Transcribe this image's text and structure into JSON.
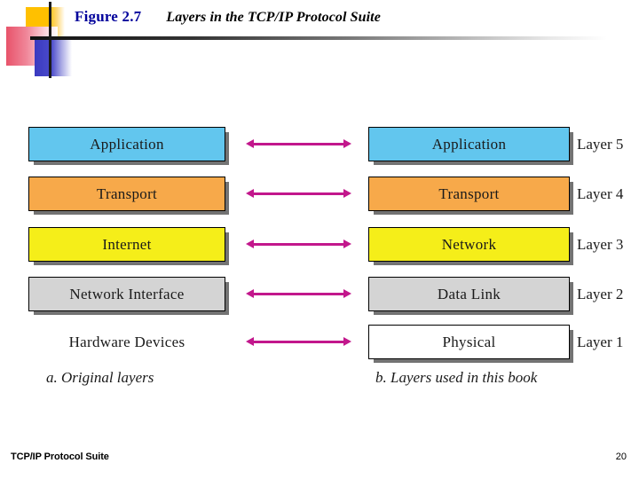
{
  "slide": {
    "title_figure": "Figure 2.7",
    "title_text": "Layers in the TCP/IP Protocol Suite",
    "accent_blue": "#00009B",
    "arrow_color": "#C2178C"
  },
  "diagram": {
    "left_column": {
      "caption": "a. Original layers",
      "rows": [
        {
          "label": "Application",
          "color": "#62C6EE",
          "boxed": true
        },
        {
          "label": "Transport",
          "color": "#F7A94A",
          "boxed": true
        },
        {
          "label": "Internet",
          "color": "#F5EE19",
          "boxed": true
        },
        {
          "label": "Network Interface",
          "color": "#D4D4D4",
          "boxed": true
        },
        {
          "label": "Hardware Devices",
          "color": "",
          "boxed": false
        }
      ]
    },
    "right_column": {
      "caption": "b. Layers used in this book",
      "rows": [
        {
          "label": "Application",
          "color": "#62C6EE",
          "layer": "Layer 5"
        },
        {
          "label": "Transport",
          "color": "#F7A94A",
          "layer": "Layer 4"
        },
        {
          "label": "Network",
          "color": "#F5EE19",
          "layer": "Layer 3"
        },
        {
          "label": "Data Link",
          "color": "#D4D4D4",
          "layer": "Layer 2"
        },
        {
          "label": "Physical",
          "color": "#FFFFFF",
          "layer": "Layer 1"
        }
      ]
    },
    "arrows": [
      {
        "name": "arrow-row-1"
      },
      {
        "name": "arrow-row-2"
      },
      {
        "name": "arrow-row-3"
      },
      {
        "name": "arrow-row-4"
      },
      {
        "name": "arrow-row-5"
      }
    ]
  },
  "footer": {
    "left_text": "TCP/IP Protocol Suite",
    "page_number": "20"
  }
}
